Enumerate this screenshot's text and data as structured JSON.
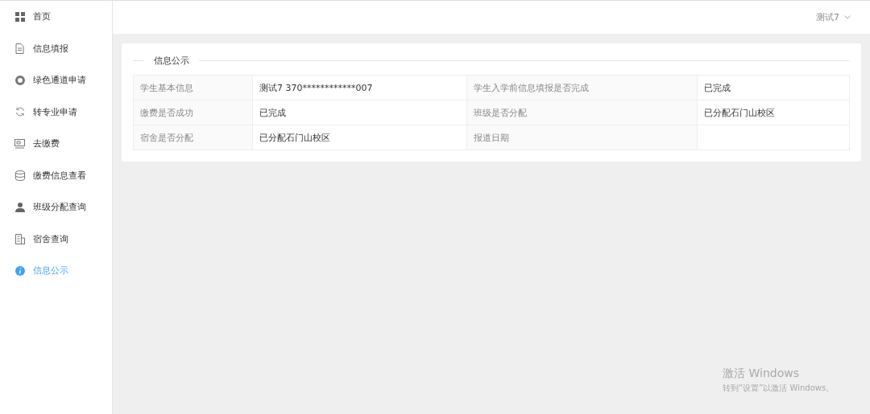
{
  "sidebar": {
    "items": [
      {
        "label": "首页",
        "kind": "grid",
        "selected": false
      },
      {
        "label": "信息填报",
        "kind": "document",
        "selected": false
      },
      {
        "label": "绿色通道申请",
        "kind": "ring",
        "selected": false
      },
      {
        "label": "转专业申请",
        "kind": "refresh",
        "selected": false
      },
      {
        "label": "去缴费",
        "kind": "card",
        "selected": false
      },
      {
        "label": "缴费信息查看",
        "kind": "database",
        "selected": false
      },
      {
        "label": "班级分配查询",
        "kind": "user",
        "selected": false
      },
      {
        "label": "宿舍查询",
        "kind": "building",
        "selected": false
      },
      {
        "label": "信息公示",
        "kind": "info",
        "selected": true
      }
    ]
  },
  "header": {
    "user": "测试7"
  },
  "card": {
    "title": "信息公示",
    "rows": [
      {
        "cells": [
          {
            "label": "学生基本信息",
            "value": "测试7 370************007"
          },
          {
            "label": "学生入学前信息填报是否完成",
            "value": "已完成"
          }
        ]
      },
      {
        "cells": [
          {
            "label": "缴费是否成功",
            "value": "已完成"
          },
          {
            "label": "班级是否分配",
            "value": "已分配石门山校区"
          }
        ]
      },
      {
        "cells": [
          {
            "label": "宿舍是否分配",
            "value": "已分配石门山校区"
          },
          {
            "label": "报道日期"
          }
        ]
      }
    ]
  },
  "os_notice": {
    "title": "激活 Windows",
    "subtitle": "转到“设置”以激活 Windows。"
  }
}
